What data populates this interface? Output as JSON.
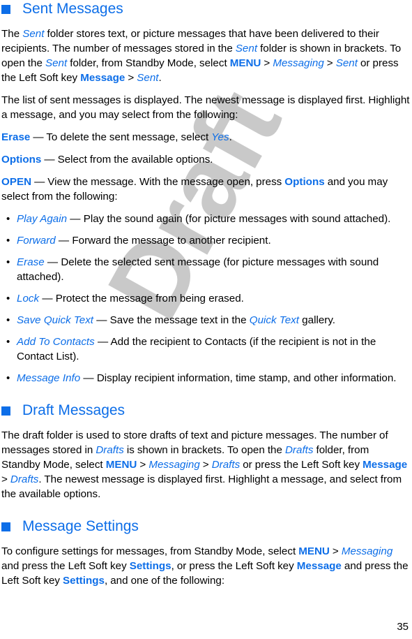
{
  "document": {
    "page_number": "35",
    "watermark": "Draft",
    "accent_color": "#0d6ee8",
    "watermark_color": "#c9c9c9",
    "background_color": "#ffffff"
  },
  "sections": [
    {
      "heading": "Sent Messages",
      "intro_1": {
        "p1": "The ",
        "p2": "Sent",
        "p3": " folder stores text, or picture messages that have been delivered to their recipients. The number of messages stored in the ",
        "p4": "Sent",
        "p5": " folder is shown in brackets. To open the ",
        "p6": "Sent",
        "p7": " folder, from Standby Mode, select ",
        "p8": "MENU",
        "p9": " > ",
        "p10": "Messaging",
        "p11": " > ",
        "p12": "Sent",
        "p13": " or press the Left Soft key ",
        "p14": "Message",
        "p15": " > ",
        "p16": "Sent",
        "p17": "."
      },
      "intro_2": "The list of sent messages is displayed. The newest message is displayed first. Highlight a message, and you may select from the following:",
      "definitions": [
        {
          "term": "Erase",
          "dash": " — ",
          "text_1": "To delete the sent message, select ",
          "emph": "Yes",
          "text_2": "."
        },
        {
          "term": "Options",
          "dash": " — ",
          "text_1": "Select from the available options.",
          "emph": "",
          "text_2": ""
        },
        {
          "term": "OPEN",
          "dash": " — ",
          "text_1": "View the message. With the message open, press ",
          "emph": "Options",
          "text_2": " and you may select from the following:"
        }
      ],
      "bullets": [
        {
          "term": "Play Again",
          "dash": " — ",
          "text_1": "Play the sound again (for picture messages with sound attached).",
          "emph": "",
          "text_2": ""
        },
        {
          "term": "Forward",
          "dash": " — ",
          "text_1": "Forward the message to another recipient.",
          "emph": "",
          "text_2": ""
        },
        {
          "term": "Erase",
          "dash": " — ",
          "text_1": "Delete the selected sent message (for picture messages with sound attached).",
          "emph": "",
          "text_2": ""
        },
        {
          "term": "Lock",
          "dash": " — ",
          "text_1": "Protect the message from being erased.",
          "emph": "",
          "text_2": ""
        },
        {
          "term": "Save Quick Text",
          "dash": " — ",
          "text_1": "Save the message text in the ",
          "emph": "Quick Text",
          "text_2": " gallery."
        },
        {
          "term": "Add To Contacts",
          "dash": " — ",
          "text_1": "Add the recipient to Contacts (if the recipient is not in the Contact List).",
          "emph": "",
          "text_2": ""
        },
        {
          "term": "Message Info",
          "dash": " — ",
          "text_1": "Display recipient information, time stamp, and other information.",
          "emph": "",
          "text_2": ""
        }
      ]
    },
    {
      "heading": "Draft Messages",
      "paragraph": {
        "p1": "The draft folder is used to store drafts of text and picture messages. The number of messages stored in ",
        "p2": "Drafts",
        "p3": " is shown in brackets. To open the ",
        "p4": "Drafts",
        "p5": " folder, from Standby Mode, select ",
        "p6": "MENU",
        "p7": " > ",
        "p8": "Messaging",
        "p9": " > ",
        "p10": "Drafts",
        "p11": " or press the Left Soft key ",
        "p12": "Message",
        "p13": " > ",
        "p14": "Drafts",
        "p15": ". The newest message is displayed first. Highlight a message, and select from the available options."
      }
    },
    {
      "heading": "Message Settings",
      "paragraph": {
        "p1": "To configure settings for messages, from Standby Mode, select ",
        "p2": "MENU",
        "p3": " > ",
        "p4": "Messaging",
        "p5": " and press the Left Soft key ",
        "p6": "Settings",
        "p7": ", or press the Left Soft key ",
        "p8": "Message",
        "p9": " and press the Left Soft key ",
        "p10": "Settings",
        "p11": ", and one of the following:"
      }
    }
  ]
}
